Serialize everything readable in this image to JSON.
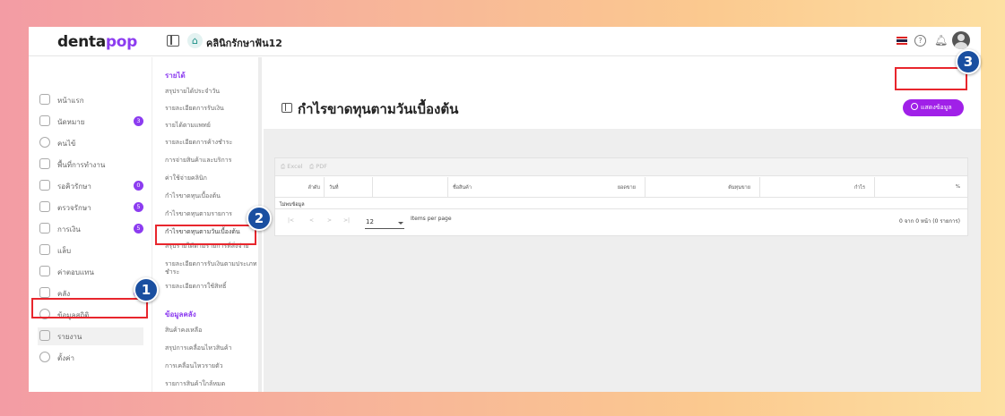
{
  "brand": {
    "logo_main": "denta",
    "logo_accent": "pop"
  },
  "header": {
    "clinic_name": "คลินิกรักษาฟัน12"
  },
  "sidebar": {
    "items": [
      {
        "label": "หน้าแรก",
        "icon": "home-icon"
      },
      {
        "label": "นัดหมาย",
        "icon": "calendar-icon",
        "badge": "3"
      },
      {
        "label": "คนไข้",
        "icon": "user-icon"
      },
      {
        "label": "พื้นที่การทำงาน",
        "icon": "workspace-icon"
      },
      {
        "label": "รอคิวรักษา",
        "icon": "chair-icon",
        "badge": "0"
      },
      {
        "label": "ตรวจรักษา",
        "icon": "treatment-icon",
        "badge": "5"
      },
      {
        "label": "การเงิน",
        "icon": "finance-icon",
        "badge": "5"
      },
      {
        "label": "แล็บ",
        "icon": "tooth-icon"
      },
      {
        "label": "ค่าตอบแทน",
        "icon": "percent-icon"
      },
      {
        "label": "คลัง",
        "icon": "inventory-icon",
        "dot": true
      },
      {
        "label": "ข้อมูลสถิติ",
        "icon": "stats-icon"
      },
      {
        "label": "รายงาน",
        "icon": "report-icon"
      },
      {
        "label": "ตั้งค่า",
        "icon": "settings-icon"
      }
    ]
  },
  "submenu": {
    "section1_title": "รายได้",
    "section1_items": [
      "สรุปรายได้ประจำวัน",
      "รายละเอียดการรับเงิน",
      "รายได้ตามแพทย์",
      "รายละเอียดการค้างชำระ",
      "การจ่ายสินค้าและบริการ",
      "ค่าใช้จ่ายคลินิก",
      "กำไรขาดทุนเบื้องต้น",
      "กำไรขาดทุนตามรายการ",
      "กำไรขาดทุนตามวันเบื้องต้น",
      "สรุปรายได้ตามรายการที่สั่งจ่าย",
      "รายละเอียดการรับเงินตามประเภทชำระ",
      "รายละเอียดการใช้สิทธิ์"
    ],
    "section2_title": "ข้อมูลคลัง",
    "section2_items": [
      "สินค้าคงเหลือ",
      "สรุปการเคลื่อนไหวสินค้า",
      "การเคลื่อนไหวรายตัว",
      "รายการสินค้าใกล้หมด"
    ]
  },
  "main": {
    "title": "กำไรขาดทุนตามวันเบื้องต้น",
    "show_button": "แสดงข้อมูล",
    "export": {
      "excel": "Excel",
      "pdf": "PDF"
    },
    "columns": [
      "ลำดับ",
      "วันที่",
      "ชื่อสินค้า",
      "ยอดขาย",
      "ต้นทุนขาย",
      "กำไร",
      "%"
    ],
    "no_data": "ไม่พบข้อมูล",
    "pager": {
      "page_size": "12",
      "items_per_page": "Items per page",
      "range": "0 จาก 0 หน้า (0 รายการ)"
    }
  },
  "annotations": [
    {
      "number": "1",
      "target": "รายงาน"
    },
    {
      "number": "2",
      "target": "กำไรขาดทุนตามวันเบื้องต้น"
    },
    {
      "number": "3",
      "target": "แสดงข้อมูล"
    }
  ],
  "colors": {
    "accent": "#8c3cf0",
    "button": "#a020e8",
    "callout_box": "#e8262d",
    "callout_badge": "#1a4fa0"
  }
}
